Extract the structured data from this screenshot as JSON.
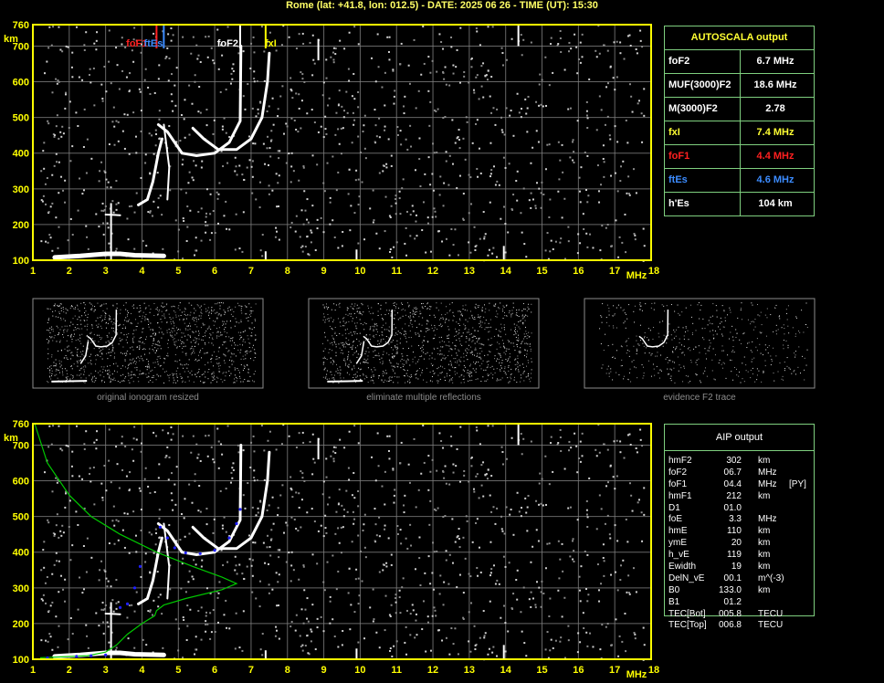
{
  "header": "Rome (lat: +41.8, lon: 012.5) - DATE: 2025 06 26 - TIME (UT): 15:30",
  "chart_data": [
    {
      "type": "scatter",
      "name": "ionogram",
      "xlabel": "MHz",
      "ylabel": "km",
      "xlim": [
        1,
        18
      ],
      "ylim": [
        100,
        760
      ],
      "x_ticks": [
        "1",
        "2",
        "3",
        "4",
        "5",
        "6",
        "7",
        "8",
        "9",
        "10",
        "11",
        "12",
        "13",
        "14",
        "15",
        "16",
        "17",
        "18"
      ],
      "y_ticks": [
        "100",
        "200",
        "300",
        "400",
        "500",
        "600",
        "700",
        "760"
      ],
      "markers": [
        {
          "label": "foF2",
          "x": 6.7,
          "color": "#ffffff"
        },
        {
          "label": "fxI",
          "x": 7.4,
          "color": "#ffff00"
        },
        {
          "label": "foF1",
          "x": 4.4,
          "color": "#ff2020"
        },
        {
          "label": "ftEs",
          "x": 4.6,
          "color": "#3c8cff"
        }
      ],
      "grid": true
    },
    {
      "type": "scatter",
      "name": "ionogram_with_profile",
      "xlabel": "MHz",
      "ylabel": "km",
      "xlim": [
        1,
        18
      ],
      "ylim": [
        100,
        760
      ],
      "x_ticks": [
        "1",
        "2",
        "3",
        "4",
        "5",
        "6",
        "7",
        "8",
        "9",
        "10",
        "11",
        "12",
        "13",
        "14",
        "15",
        "16",
        "17",
        "18"
      ],
      "y_ticks": [
        "100",
        "200",
        "300",
        "400",
        "500",
        "600",
        "700",
        "760"
      ],
      "grid": true
    }
  ],
  "thumbnails": [
    {
      "caption": "original ionogram resized"
    },
    {
      "caption": "eliminate multiple reflections"
    },
    {
      "caption": "evidence F2 trace"
    }
  ],
  "autoscala": {
    "title": "AUTOSCALA output",
    "rows": [
      {
        "key": "foF2",
        "value": "6.7 MHz",
        "color": "#ffffff"
      },
      {
        "key": "MUF(3000)F2",
        "value": "18.6 MHz",
        "color": "#ffffff"
      },
      {
        "key": "M(3000)F2",
        "value": "2.78",
        "color": "#ffffff"
      },
      {
        "key": "fxI",
        "value": "7.4 MHz",
        "color": "#ffff33"
      },
      {
        "key": "foF1",
        "value": "4.4 MHz",
        "color": "#ff2020"
      },
      {
        "key": "ftEs",
        "value": "4.6 MHz",
        "color": "#3c8cff"
      },
      {
        "key": "h'Es",
        "value": "104 km",
        "color": "#ffffff"
      }
    ]
  },
  "aip": {
    "title": "AIP output",
    "rows": [
      {
        "key": "hmF2",
        "value": "302",
        "unit": "km",
        "extra": ""
      },
      {
        "key": "foF2",
        "value": "06.7",
        "unit": "MHz",
        "extra": ""
      },
      {
        "key": "foF1",
        "value": "04.4",
        "unit": "MHz",
        "extra": "[PY]"
      },
      {
        "key": "hmF1",
        "value": "212",
        "unit": "km",
        "extra": ""
      },
      {
        "key": "D1",
        "value": "01.0",
        "unit": "",
        "extra": ""
      },
      {
        "key": "foE",
        "value": "3.3",
        "unit": "MHz",
        "extra": ""
      },
      {
        "key": "hmE",
        "value": "110",
        "unit": "km",
        "extra": ""
      },
      {
        "key": "ymE",
        "value": "20",
        "unit": "km",
        "extra": ""
      },
      {
        "key": "h_vE",
        "value": "119",
        "unit": "km",
        "extra": ""
      },
      {
        "key": "Ewidth",
        "value": "19",
        "unit": "km",
        "extra": ""
      },
      {
        "key": "DelN_vE",
        "value": "00.1",
        "unit": "m^(-3)",
        "extra": ""
      },
      {
        "key": "B0",
        "value": "133.0",
        "unit": "km",
        "extra": ""
      },
      {
        "key": "B1",
        "value": "01.2",
        "unit": "",
        "extra": ""
      },
      {
        "key": "TEC[Bot]",
        "value": "005.8",
        "unit": "TECU",
        "extra": ""
      },
      {
        "key": "TEC[Top]",
        "value": "006.8",
        "unit": "TECU",
        "extra": ""
      }
    ]
  },
  "colors": {
    "axis": "#ffff00",
    "grid": "#808080",
    "table_border": "#7fcf7f",
    "profile": "#00c800",
    "fit": "#2020ff"
  }
}
